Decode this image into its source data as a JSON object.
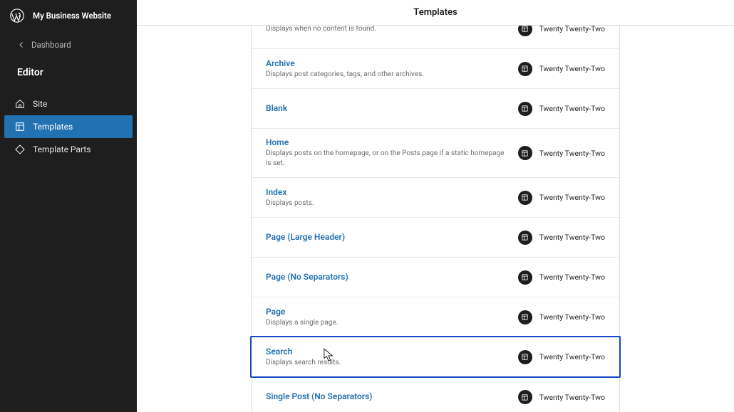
{
  "sidebar": {
    "site_name": "My Business Website",
    "back_label": "Dashboard",
    "editor_label": "Editor",
    "nav": [
      {
        "key": "site",
        "label": "Site",
        "icon": "home-icon",
        "active": false
      },
      {
        "key": "templates",
        "label": "Templates",
        "icon": "layout-icon",
        "active": true
      },
      {
        "key": "template-parts",
        "label": "Template Parts",
        "icon": "diamond-icon",
        "active": false
      }
    ]
  },
  "header": {
    "title": "Templates"
  },
  "theme_name": "Twenty Twenty-Two",
  "templates": [
    {
      "key": "404",
      "title": "",
      "desc": "Displays when no content is found.",
      "highlight": false
    },
    {
      "key": "archive",
      "title": "Archive",
      "desc": "Displays post categories, tags, and other archives.",
      "highlight": false
    },
    {
      "key": "blank",
      "title": "Blank",
      "desc": "",
      "highlight": false
    },
    {
      "key": "home",
      "title": "Home",
      "desc": "Displays posts on the homepage, or on the Posts page if a static homepage is set.",
      "highlight": false
    },
    {
      "key": "index",
      "title": "Index",
      "desc": "Displays posts.",
      "highlight": false
    },
    {
      "key": "page-large-header",
      "title": "Page (Large Header)",
      "desc": "",
      "highlight": false
    },
    {
      "key": "page-no-separators",
      "title": "Page (No Separators)",
      "desc": "",
      "highlight": false
    },
    {
      "key": "page",
      "title": "Page",
      "desc": "Displays a single page.",
      "highlight": false
    },
    {
      "key": "search",
      "title": "Search",
      "desc": "Displays search results.",
      "highlight": true
    },
    {
      "key": "single-no-sep",
      "title": "Single Post (No Separators)",
      "desc": "",
      "highlight": false
    }
  ]
}
